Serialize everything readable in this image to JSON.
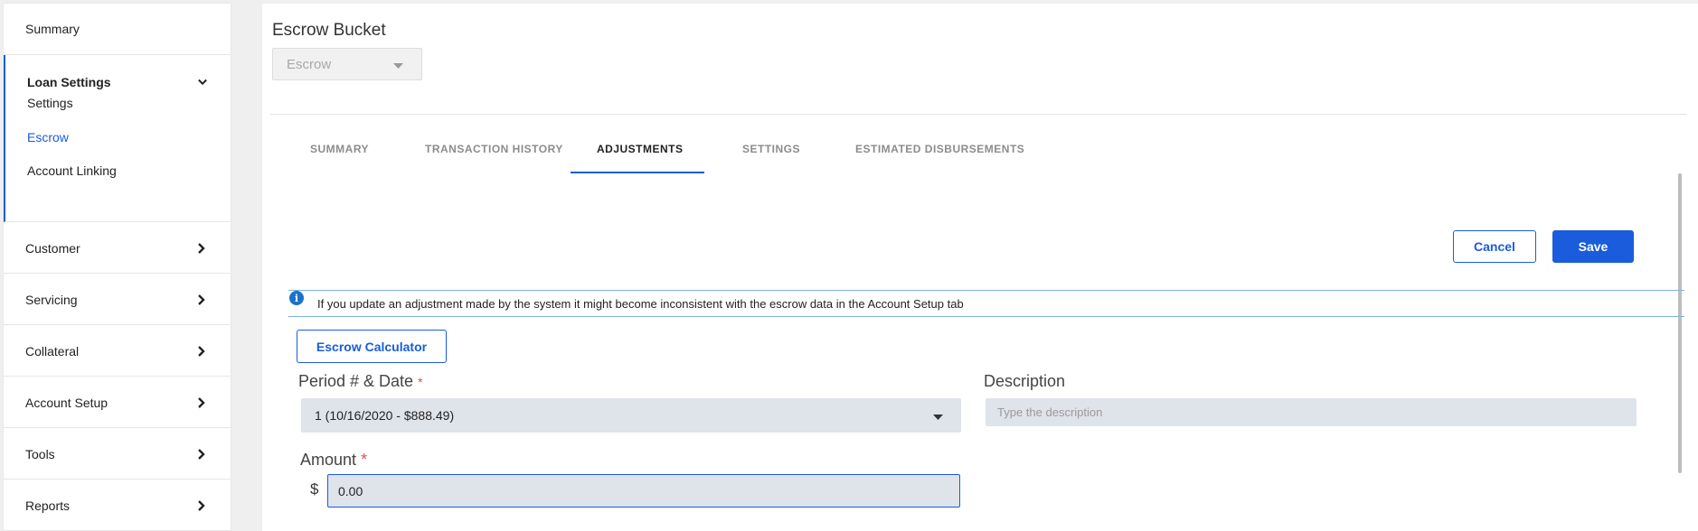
{
  "sidebar": {
    "summary": "Summary",
    "loan_settings": {
      "label": "Loan Settings",
      "items": [
        "Settings",
        "Escrow",
        "Account Linking"
      ],
      "active": "Escrow"
    },
    "sections": [
      "Customer",
      "Servicing",
      "Collateral",
      "Account Setup",
      "Tools",
      "Reports"
    ]
  },
  "main": {
    "bucket_label": "Escrow Bucket",
    "bucket_value": "Escrow",
    "tabs": [
      "SUMMARY",
      "TRANSACTION HISTORY",
      "ADJUSTMENTS",
      "SETTINGS",
      "ESTIMATED DISBURSEMENTS"
    ],
    "active_tab": "ADJUSTMENTS",
    "cancel_label": "Cancel",
    "save_label": "Save",
    "info_message": "If you update an adjustment made by the system it might become inconsistent with the escrow data in the Account Setup tab",
    "calculator_label": "Escrow Calculator",
    "period_label": "Period # & Date",
    "period_value": "1 (10/16/2020 - $888.49)",
    "description_label": "Description",
    "description_placeholder": "Type the description",
    "amount_label": "Amount",
    "currency_symbol": "$",
    "amount_value": "0.00",
    "required_marker": "*"
  },
  "colors": {
    "accent": "#1a5cdb",
    "field_bg": "#dfe3ea",
    "info_icon": "#1a73c9"
  }
}
